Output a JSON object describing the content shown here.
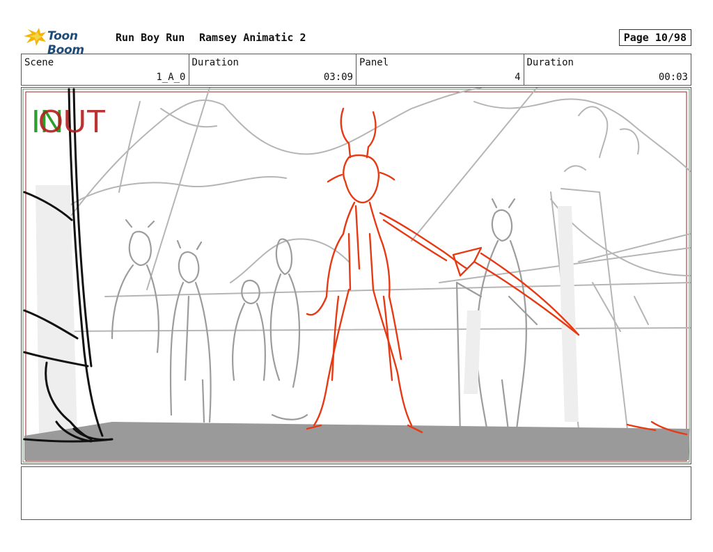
{
  "header": {
    "logo_text": "Toon Boom",
    "project": "Run Boy Run",
    "scene_title": "Ramsey Animatic 2",
    "page": "Page 10/98"
  },
  "info": {
    "scene_label": "Scene",
    "scene_value": "1_A_0",
    "duration_label": "Duration",
    "duration_value": "03:09",
    "panel_label": "Panel",
    "panel_value": "4",
    "panel_duration_label": "Duration",
    "panel_duration_value": "00:03"
  },
  "panel": {
    "in_marker": "IN",
    "out_marker": "OUT"
  },
  "notes": {
    "text": ""
  },
  "colors": {
    "brand": "#1f4b78",
    "logo_flame": "#f2b705",
    "in_marker": "#2e9e2e",
    "out_marker": "#b21e1e",
    "hero_sketch": "#e63a14",
    "background_sketch": "#a8a8a8",
    "ground": "#9a9a9a"
  }
}
